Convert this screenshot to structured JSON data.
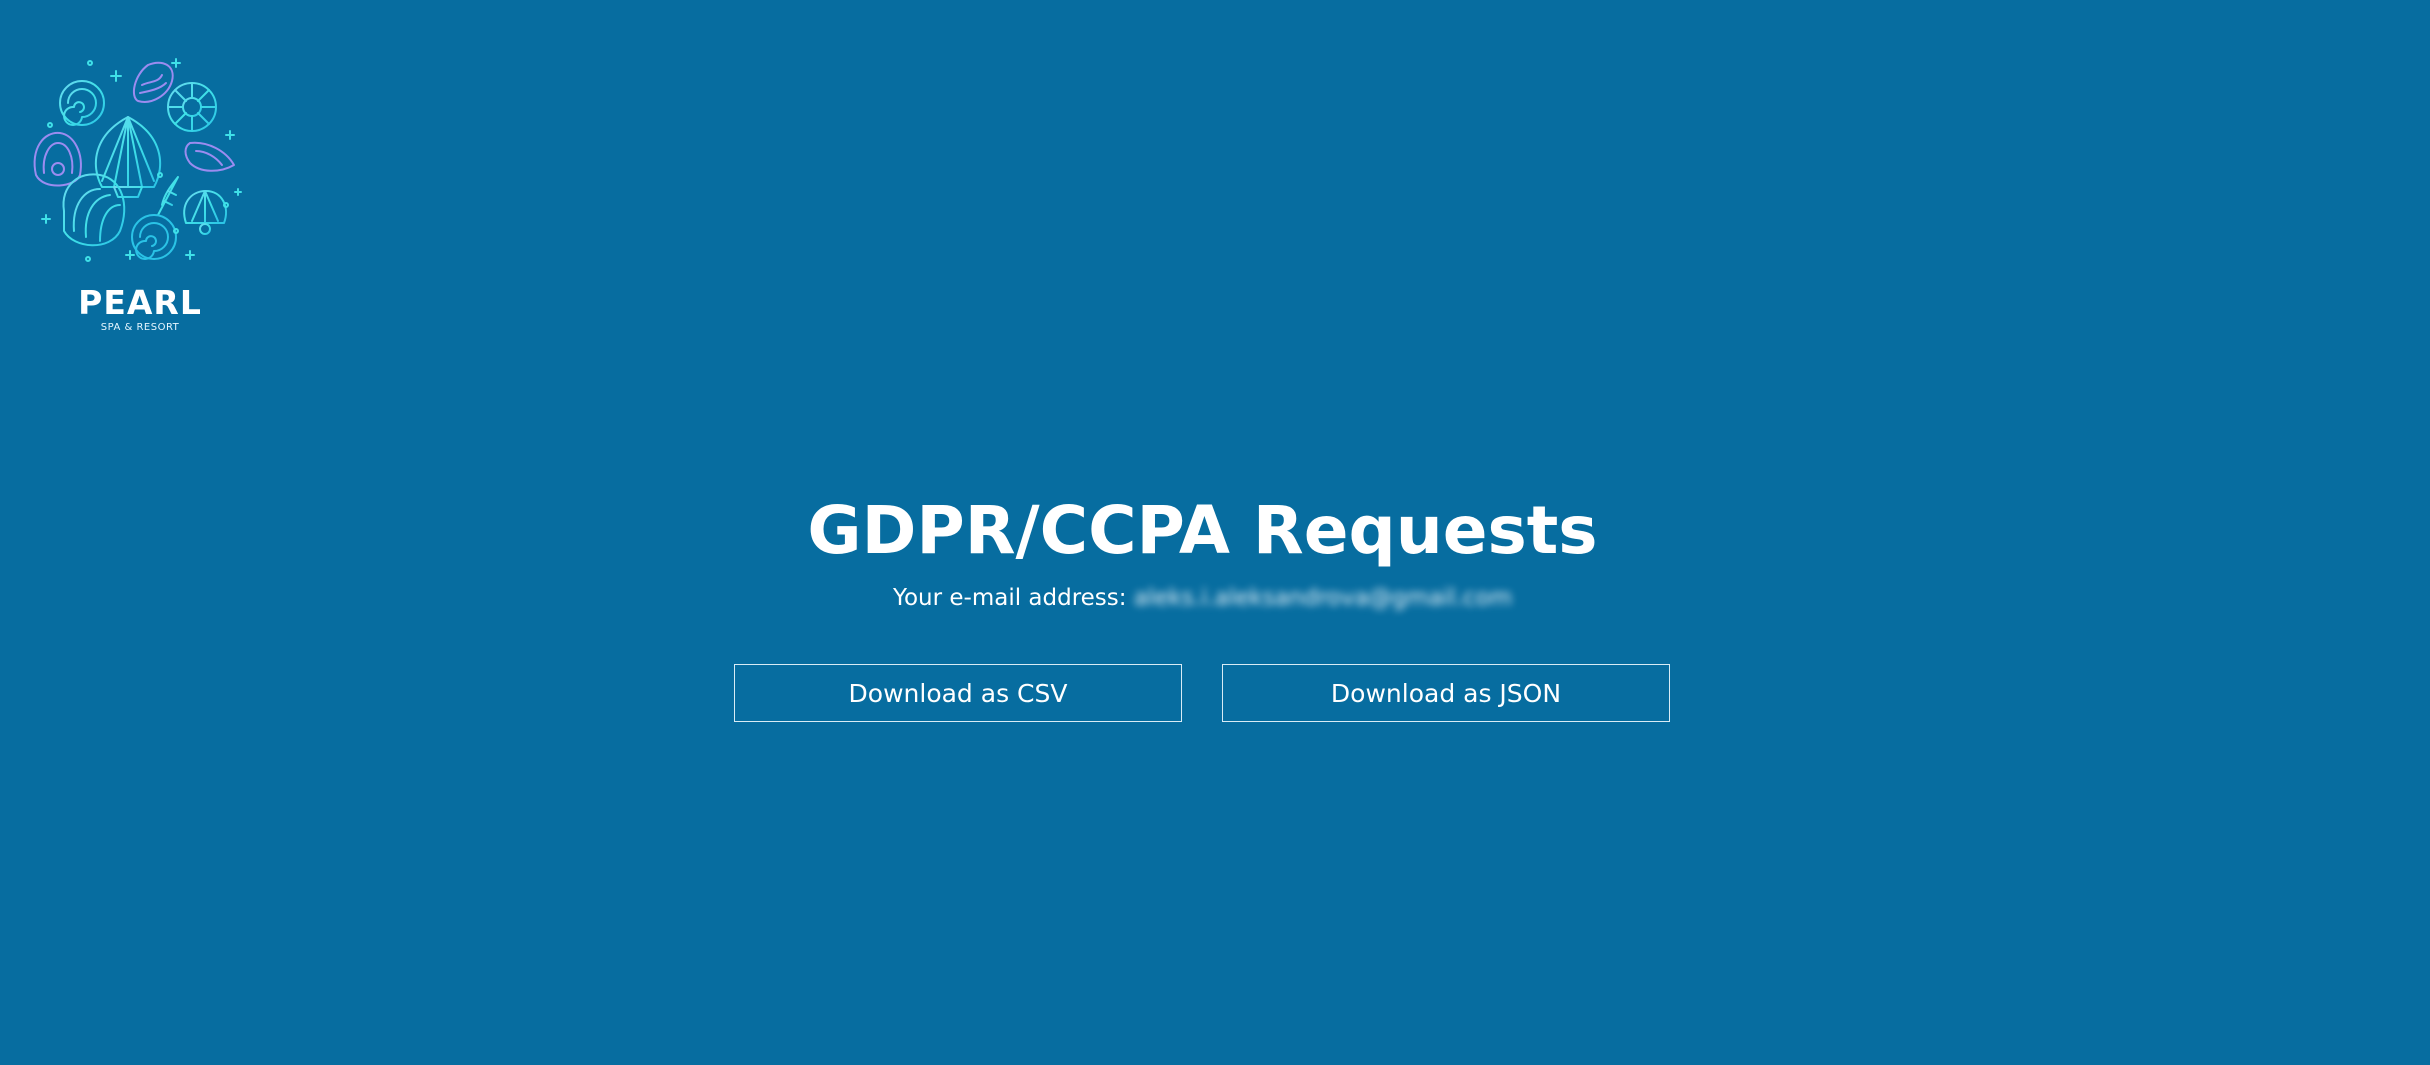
{
  "brand": {
    "name": "PEARL",
    "tagline": "SPA & RESORT",
    "logo_icon": "seashell-cluster-icon"
  },
  "main": {
    "title": "GDPR/CCPA Requests",
    "email_label": "Your e-mail address:",
    "email_value": "aleks.i.aleksandrova@gmail.com"
  },
  "actions": {
    "download_csv_label": "Download as CSV",
    "download_json_label": "Download as JSON"
  },
  "colors": {
    "background": "#076da0",
    "text": "#ffffff",
    "logo_cyan": "#3fe0e8",
    "logo_purple": "#9b8cf0"
  }
}
